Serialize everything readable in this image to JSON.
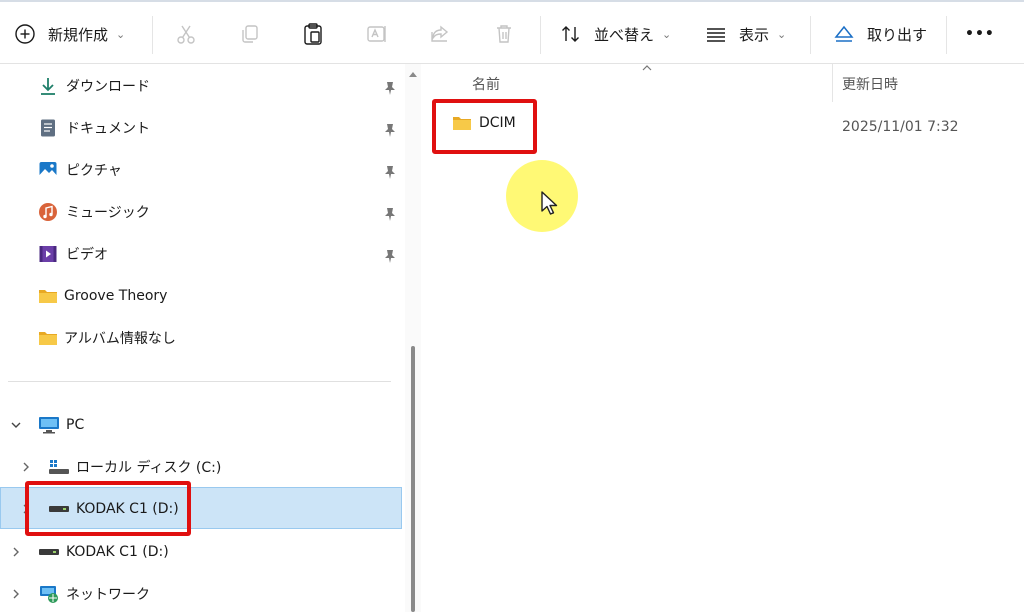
{
  "toolbar": {
    "new_label": "新規作成",
    "sort_label": "並べ替え",
    "view_label": "表示",
    "eject_label": "取り出す",
    "more_label": "•••"
  },
  "nav": {
    "quick_access": [
      {
        "label": "ダウンロード",
        "icon": "download-icon"
      },
      {
        "label": "ドキュメント",
        "icon": "document-icon"
      },
      {
        "label": "ピクチャ",
        "icon": "pictures-icon"
      },
      {
        "label": "ミュージック",
        "icon": "music-icon"
      },
      {
        "label": "ビデオ",
        "icon": "video-icon"
      },
      {
        "label": "Groove Theory",
        "icon": "folder-icon"
      },
      {
        "label": "アルバム情報なし",
        "icon": "folder-icon"
      }
    ],
    "pc_label": "PC",
    "local_disk_label": "ローカル ディスク (C:)",
    "kodak_selected_label": "KODAK C1 (D:)",
    "kodak_label": "KODAK C1 (D:)",
    "network_label": "ネットワーク"
  },
  "main": {
    "col_name": "名前",
    "col_date": "更新日時",
    "files": [
      {
        "name": "DCIM",
        "modified": "2025/11/01 7:32",
        "icon": "folder-icon"
      }
    ]
  },
  "colors": {
    "accent_blue": "#1e6fc6",
    "selection": "#cce4f7",
    "highlight_red": "#e01010",
    "cursor_highlight": "#fff640",
    "folder_yellow": "#f7c948"
  }
}
